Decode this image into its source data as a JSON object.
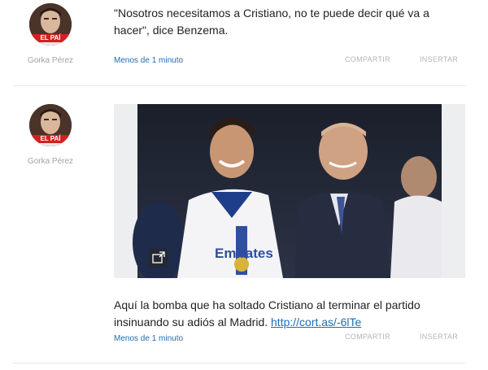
{
  "posts": [
    {
      "author": "Gorka Pérez",
      "avatar_badge": "EL PAÍ",
      "text": "\"Nosotros necesitamos a Cristiano, no te puede decir qué va a hacer\", dice Benzema.",
      "time": "Menos de 1 minuto",
      "share_label": "COMPARTIR",
      "embed_label": "INSERTAR"
    },
    {
      "author": "Gorka Pérez",
      "avatar_badge": "EL PAÍ",
      "text": "Aquí la bomba que ha soltado Cristiano al terminar el partido insinuando su adiós al Madrid. ",
      "link": "http://cort.as/-6lTe",
      "time": "Menos de 1 minuto",
      "share_label": "COMPARTIR",
      "embed_label": "INSERTAR",
      "photo": {
        "jersey_text": "Emirates",
        "icon": "expand-icon"
      }
    }
  ],
  "colors": {
    "link": "#1f6db2",
    "muted": "#a3a3a3",
    "badge": "#d42020"
  }
}
